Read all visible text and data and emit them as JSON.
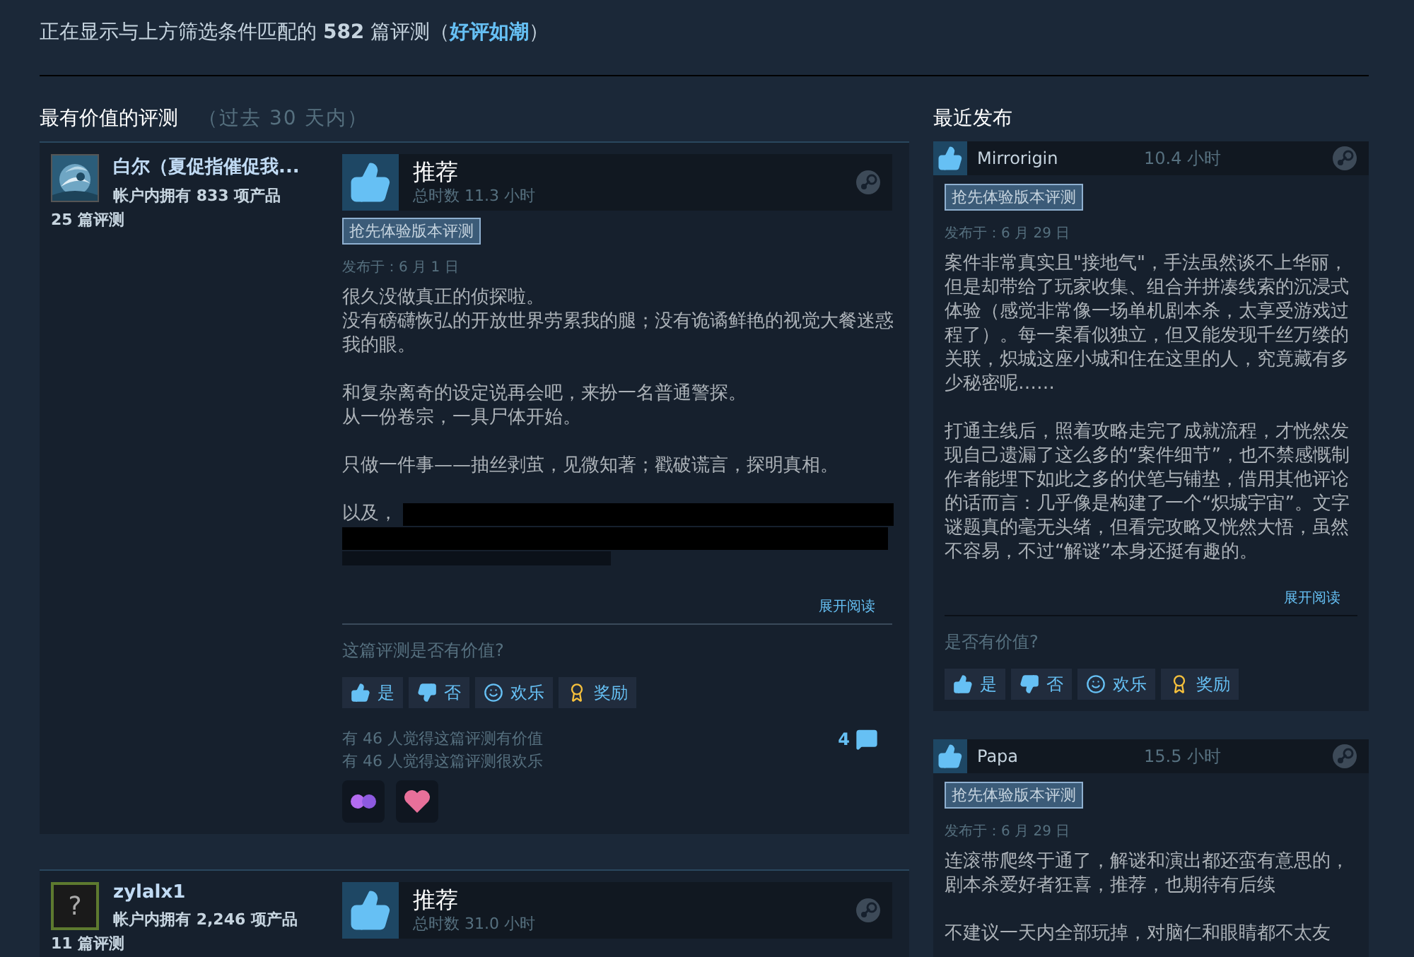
{
  "summary": {
    "text": "正在显示与上方筛选条件匹配的 **582** 篇评测（",
    "rating": "好评如潮",
    "close": "）"
  },
  "most_helpful": {
    "title": "最有价值的评测",
    "period": "（过去 30 天内）",
    "reviews": [
      {
        "author": "白尔（夏促指催促我...",
        "avatar": {
          "kind": "picture"
        },
        "products": "帐户内拥有 833 项产品",
        "review_count": "25 篇评测",
        "recommended": true,
        "verdict": "推荐",
        "hours": "总时数 11.3 小时",
        "badge": "抢先体验版本评测",
        "posted": "发布于：6 月 1 日",
        "paragraphs": [
          [
            "很久没做真正的侦探啦。",
            "没有磅礴恢弘的开放世界劳累我的腿；没有诡谲鲜艳的视觉大餐迷惑我的眼。"
          ],
          [
            "和复杂离奇的设定说再会吧，来扮一名普通警探。",
            "从一份卷宗，一具尸体开始。"
          ],
          [
            "只做一件事——抽丝剥茧，见微知著；戳破谎言，探明真相。"
          ]
        ],
        "spoiler_lead": "以及，",
        "read_more": "展开阅读",
        "helpful_question": "这篇评测是否有价值?",
        "votes": [
          {
            "kind": "yes",
            "label": "是"
          },
          {
            "kind": "no",
            "label": "否"
          },
          {
            "kind": "funny",
            "label": "欢乐"
          },
          {
            "kind": "award",
            "label": "奖励"
          }
        ],
        "helpful_count": "有 46 人觉得这篇评测有价值",
        "funny_count": "有 46 人觉得这篇评测很欢乐",
        "comments": "4",
        "awards": [
          {
            "kind": "butterfly"
          },
          {
            "kind": "heart"
          }
        ]
      },
      {
        "author": "zylalx1",
        "avatar": {
          "kind": "placeholder",
          "glyph": "?"
        },
        "products": "帐户内拥有 2,246 项产品",
        "review_count": "11 篇评测",
        "recommended": true,
        "verdict": "推荐",
        "hours": "总时数 31.0 小时"
      }
    ]
  },
  "recent": {
    "title": "最近发布",
    "reviews": [
      {
        "author": "Mirrorigin",
        "recommended": true,
        "hours": "10.4 小时",
        "badge": "抢先体验版本评测",
        "posted": "发布于：6 月 29 日",
        "paragraphs": [
          [
            "案件非常真实且\"接地气\"，手法虽然谈不上华丽，但是却带给了玩家收集、组合并拼凑线索的沉浸式体验（感觉非常像一场单机剧本杀，太享受游戏过程了）。每一案看似独立，但又能发现千丝万缕的关联，炽城这座小城和住在这里的人，究竟藏有多少秘密呢……"
          ],
          [
            "打通主线后，照着攻略走完了成就流程，才恍然发现自己遗漏了这么多的“案件细节”，也不禁感慨制作者能埋下如此之多的伏笔与铺垫，借用其他评论的话而言：几乎像是构建了一个“炽城宇宙”。文字谜题真的毫无头绪，但看完攻略又恍然大悟，虽然不容易，不过“解谜”本身还挺有趣的。"
          ]
        ],
        "read_more": "展开阅读",
        "helpful_question": "是否有价值?",
        "votes": [
          {
            "kind": "yes",
            "label": "是"
          },
          {
            "kind": "no",
            "label": "否"
          },
          {
            "kind": "funny",
            "label": "欢乐"
          },
          {
            "kind": "award",
            "label": "奖励"
          }
        ]
      },
      {
        "author": "Papa",
        "recommended": true,
        "hours": "15.5 小时",
        "badge": "抢先体验版本评测",
        "posted": "发布于：6 月 29 日",
        "paragraphs": [
          [
            "连滚带爬终于通了，解谜和演出都还蛮有意思的，剧本杀爱好者狂喜，推荐，也期待有后续"
          ],
          [
            "不建议一天内全部玩掉，对脑仁和眼睛都不太友"
          ]
        ]
      }
    ]
  }
}
